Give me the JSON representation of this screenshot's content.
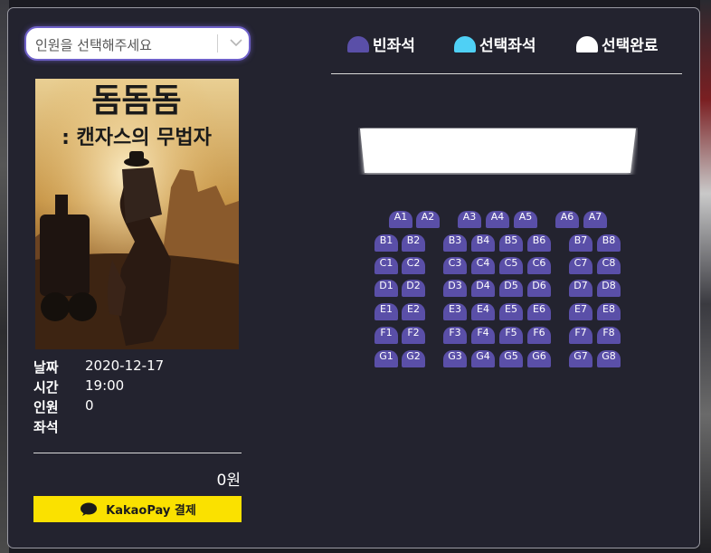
{
  "select": {
    "placeholder": "인원을 선택해주세요"
  },
  "poster": {
    "title_line1": "돔돔돔",
    "title_line2": ": 캔자스의 무법자"
  },
  "info": {
    "date_label": "날짜",
    "date_value": "2020-12-17",
    "time_label": "시간",
    "time_value": "19:00",
    "people_label": "인원",
    "people_value": "0",
    "seat_label": "좌석",
    "seat_value": ""
  },
  "price": "0원",
  "pay_button": {
    "label": "KakaoPay 결제",
    "icon": "speech-bubble-icon"
  },
  "legend": [
    {
      "label": "빈좌석",
      "color": "#5a4fa8"
    },
    {
      "label": "선택좌석",
      "color": "#4fd0f5"
    },
    {
      "label": "선택완료",
      "color": "#ffffff"
    }
  ],
  "colors": {
    "seat_empty": "#5a4fa8",
    "modal_bg": "#23232f",
    "pay_bg": "#fae100"
  },
  "seat_rows": [
    {
      "row": "A",
      "seats": [
        "A1",
        "A2",
        "A3",
        "A4",
        "A5",
        "A6",
        "A7"
      ]
    },
    {
      "row": "B",
      "seats": [
        "B1",
        "B2",
        "B3",
        "B4",
        "B5",
        "B6",
        "B7",
        "B8"
      ]
    },
    {
      "row": "C",
      "seats": [
        "C1",
        "C2",
        "C3",
        "C4",
        "C5",
        "C6",
        "C7",
        "C8"
      ]
    },
    {
      "row": "D",
      "seats": [
        "D1",
        "D2",
        "D3",
        "D4",
        "D5",
        "D6",
        "D7",
        "D8"
      ]
    },
    {
      "row": "E",
      "seats": [
        "E1",
        "E2",
        "E3",
        "E4",
        "E5",
        "E6",
        "E7",
        "E8"
      ]
    },
    {
      "row": "F",
      "seats": [
        "F1",
        "F2",
        "F3",
        "F4",
        "F5",
        "F6",
        "F7",
        "F8"
      ]
    },
    {
      "row": "G",
      "seats": [
        "G1",
        "G2",
        "G3",
        "G4",
        "G5",
        "G6",
        "G7",
        "G8"
      ]
    }
  ]
}
